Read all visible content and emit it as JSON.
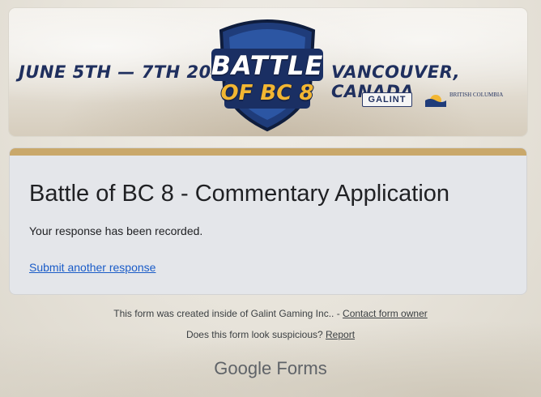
{
  "banner": {
    "date": "JUNE 5TH — 7TH 2026",
    "location": "VANCOUVER, CANADA",
    "logo_line1": "BATTLE",
    "logo_line2": "OF BC 8",
    "sponsor_galint": "GALINT",
    "sponsor_bc": "BRITISH COLUMBIA",
    "accent_color": "#1f2f5e",
    "gold_color": "#f2b632"
  },
  "form": {
    "title": "Battle of BC 8 - Commentary Application",
    "message": "Your response has been recorded.",
    "submit_another": "Submit another response",
    "theme_color": "#c9a86b"
  },
  "footer": {
    "created_text": "This form was created inside of Galint Gaming Inc.. - ",
    "contact_link": "Contact form owner",
    "suspicious_text": "Does this form look suspicious? ",
    "report_link": "Report",
    "brand_google": "Google",
    "brand_forms": "Forms"
  }
}
